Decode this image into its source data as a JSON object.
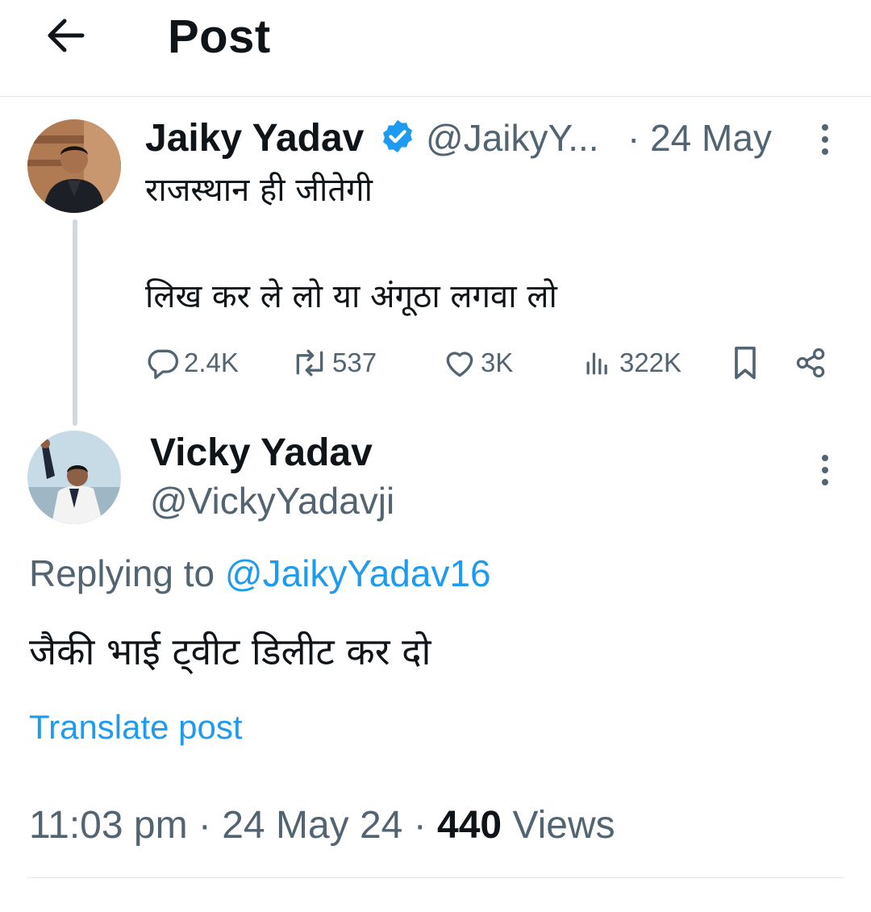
{
  "header": {
    "title": "Post"
  },
  "original_tweet": {
    "author_name": "Jaiky Yadav",
    "verified": true,
    "handle": "@JaikyY...",
    "date": "· 24 May",
    "line1": "राजस्थान ही जीतेगी",
    "line2": "लिख कर ले लो या अंगूठा लगवा लो",
    "stats": {
      "replies": "2.4K",
      "reposts": "537",
      "likes": "3K",
      "views": "322K"
    }
  },
  "reply_tweet": {
    "author_name": "Vicky Yadav",
    "handle": "@VickyYadavji",
    "replying_prefix": "Replying to",
    "replying_to": "@JaikyYadav16",
    "text": "जैकी भाई ट्वीट डिलीट कर दो",
    "translate_label": "Translate post",
    "time": "11:03 pm",
    "date": "24 May 24",
    "views_count": "440",
    "views_label": "Views"
  },
  "colors": {
    "accent": "#1d9bf0",
    "text": "#0f1419",
    "muted": "#536471",
    "border": "#e1e5e8"
  },
  "icons": [
    "back-arrow-icon",
    "verified-badge-icon",
    "more-options-icon",
    "reply-icon",
    "repost-icon",
    "like-icon",
    "views-icon",
    "bookmark-icon",
    "share-icon"
  ]
}
